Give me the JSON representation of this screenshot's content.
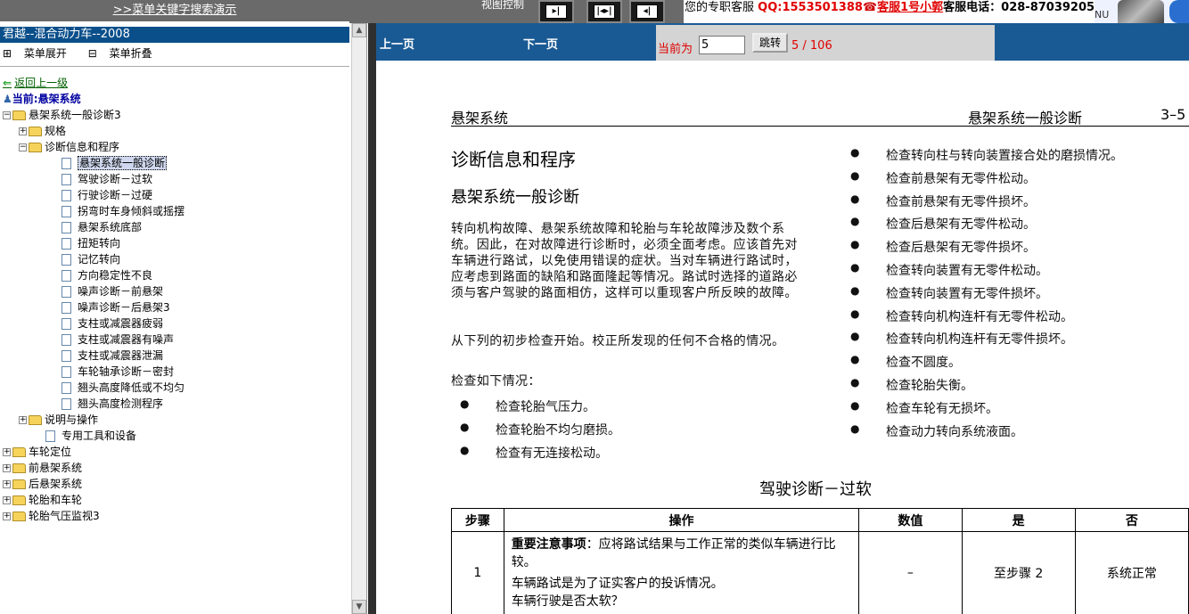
{
  "topbar": {
    "search_demo_link": ">>菜单关键字搜索演示",
    "view_control_label": "视图控制",
    "view_buttons": [
      "▸|",
      "|◂▸|",
      "◂|"
    ],
    "service_label": "您的专职客服",
    "qq": "QQ:1553501388",
    "agent": "客服1号小郭",
    "tel": "客服电话：028-87039205",
    "logo_text": "NU"
  },
  "sidebar": {
    "title": "君越--混合动力车--2008",
    "expand_label": "菜单展开",
    "collapse_label": "菜单折叠",
    "back_link": "返回上一级",
    "current_label": "当前:悬架系统",
    "tree": [
      {
        "type": "folder",
        "label": "悬架系统一般诊断3",
        "level": 0,
        "toggle": "-"
      },
      {
        "type": "folder",
        "label": "规格",
        "level": 1,
        "toggle": "+"
      },
      {
        "type": "folder",
        "label": "诊断信息和程序",
        "level": 1,
        "toggle": "-"
      },
      {
        "type": "doc",
        "label": "悬架系统一般诊断",
        "level": 2,
        "selected": true
      },
      {
        "type": "doc",
        "label": "驾驶诊断－过软",
        "level": 2
      },
      {
        "type": "doc",
        "label": "行驶诊断－过硬",
        "level": 2
      },
      {
        "type": "doc",
        "label": "拐弯时车身倾斜或摇摆",
        "level": 2
      },
      {
        "type": "doc",
        "label": "悬架系统底部",
        "level": 2
      },
      {
        "type": "doc",
        "label": "扭矩转向",
        "level": 2
      },
      {
        "type": "doc",
        "label": "记忆转向",
        "level": 2
      },
      {
        "type": "doc",
        "label": "方向稳定性不良",
        "level": 2
      },
      {
        "type": "doc",
        "label": "噪声诊断－前悬架",
        "level": 2
      },
      {
        "type": "doc",
        "label": "噪声诊断－后悬架3",
        "level": 2
      },
      {
        "type": "doc",
        "label": "支柱或减震器疲弱",
        "level": 2
      },
      {
        "type": "doc",
        "label": "支柱或减震器有噪声",
        "level": 2
      },
      {
        "type": "doc",
        "label": "支柱或减震器泄漏",
        "level": 2
      },
      {
        "type": "doc",
        "label": "车轮轴承诊断－密封",
        "level": 2
      },
      {
        "type": "doc",
        "label": "翘头高度降低或不均匀",
        "level": 2
      },
      {
        "type": "doc",
        "label": "翘头高度检测程序",
        "level": 2
      },
      {
        "type": "folder",
        "label": "说明与操作",
        "level": 1,
        "toggle": "+"
      },
      {
        "type": "doc",
        "label": "专用工具和设备",
        "level": 1
      },
      {
        "type": "folder",
        "label": "车轮定位",
        "level": 0,
        "toggle": "+"
      },
      {
        "type": "folder",
        "label": "前悬架系统",
        "level": 0,
        "toggle": "+"
      },
      {
        "type": "folder",
        "label": "后悬架系统",
        "level": 0,
        "toggle": "+"
      },
      {
        "type": "folder",
        "label": "轮胎和车轮",
        "level": 0,
        "toggle": "+"
      },
      {
        "type": "folder",
        "label": "轮胎气压监视3",
        "level": 0,
        "toggle": "+"
      }
    ]
  },
  "nav": {
    "prev": "上一页",
    "next": "下一页",
    "current_label": "当前为",
    "page_value": "5",
    "jump_label": "跳转",
    "page_count": "5 / 106"
  },
  "doc": {
    "header_left": "悬架系统",
    "header_right": "悬架系统一般诊断",
    "header_page": "3–5",
    "section_title": "诊断信息和程序",
    "subtitle": "悬架系统一般诊断",
    "para1": "转向机构故障、悬架系统故障和轮胎与车轮故障涉及数个系统。因此，在对故障进行诊断时，必须全面考虑。应该首先对车辆进行路试，以免使用错误的症状。当对车辆进行路试时，应考虑到路面的缺陷和路面隆起等情况。路试时选择的道路必须与客户驾驶的路面相仿，这样可以重现客户所反映的故障。",
    "para2": "从下列的初步检查开始。校正所发现的任何不合格的情况。",
    "para3": "检查如下情况：",
    "left_bullets": [
      "检查轮胎气压力。",
      "检查轮胎不均匀磨损。",
      "检查有无连接松动。"
    ],
    "right_bullets": [
      "检查转向柱与转向装置接合处的磨损情况。",
      "检查前悬架有无零件松动。",
      "检查前悬架有无零件损坏。",
      "检查后悬架有无零件松动。",
      "检查后悬架有无零件损坏。",
      "检查转向装置有无零件松动。",
      "检查转向装置有无零件损坏。",
      "检查转向机构连杆有无零件松动。",
      "检查转向机构连杆有无零件损坏。",
      "检查不圆度。",
      "检查轮胎失衡。",
      "检查车轮有无损坏。",
      "检查动力转向系统液面。"
    ],
    "section2_title": "驾驶诊断－过软",
    "table": {
      "headers": [
        "步骤",
        "操作",
        "数值",
        "是",
        "否"
      ],
      "row1": {
        "step": "1",
        "note_label": "重要注意事项",
        "note_text": "：应将路试结果与工作正常的类似车辆进行比较。",
        "line2": "车辆路试是为了证实客户的投诉情况。",
        "line3": "车辆行驶是否太软？",
        "value": "–",
        "yes": "至步骤 2",
        "no": "系统正常"
      }
    }
  }
}
